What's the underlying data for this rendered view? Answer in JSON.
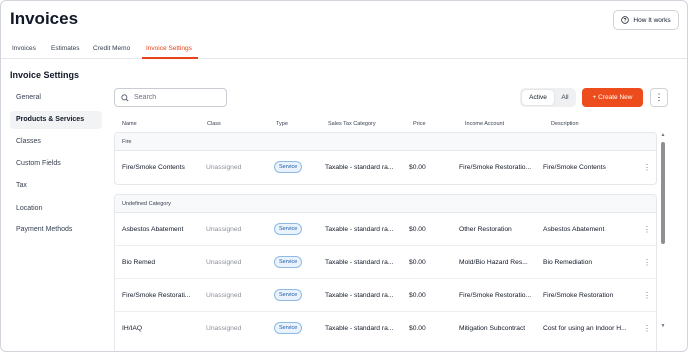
{
  "header": {
    "title": "Invoices",
    "how_label": "How It works",
    "how_icon": "help-circle-icon"
  },
  "tabs": [
    {
      "label": "Invoices"
    },
    {
      "label": "Estimates"
    },
    {
      "label": "Credit Memo"
    },
    {
      "label": "Invoice Settings",
      "active": true
    }
  ],
  "sidebar": {
    "title": "Invoice Settings",
    "items": [
      {
        "label": "General"
      },
      {
        "label": "Products & Services",
        "active": true
      },
      {
        "label": "Classes"
      },
      {
        "label": "Custom Fields"
      },
      {
        "label": "Tax"
      },
      {
        "label": "Location"
      },
      {
        "label": "Payment Methods"
      }
    ]
  },
  "toolbar": {
    "search_placeholder": "Search",
    "toggle_active": "Active",
    "toggle_all": "All",
    "create_label": "+ Create New",
    "more_icon": "kebab-icon"
  },
  "table": {
    "columns": [
      "Name",
      "Class",
      "Type",
      "Sales Tax Category",
      "Price",
      "Income Account",
      "Description"
    ],
    "groups": [
      {
        "name": "Fire",
        "rows": [
          {
            "name": "Fire/Smoke Contents",
            "class": "Unassigned",
            "type": "Service",
            "tax": "Taxable - standard ra...",
            "price": "$0.00",
            "income": "Fire/Smoke Restoratio...",
            "description": "Fire/Smoke Contents"
          }
        ]
      },
      {
        "name": "Undefined Category",
        "rows": [
          {
            "name": "Asbestos Abatement",
            "class": "Unassigned",
            "type": "Service",
            "tax": "Taxable - standard ra...",
            "price": "$0.00",
            "income": "Other Restoration",
            "description": "Asbestos Abatement"
          },
          {
            "name": "Bio Remed",
            "class": "Unassigned",
            "type": "Service",
            "tax": "Taxable - standard ra...",
            "price": "$0.00",
            "income": "Mold/Bio Hazard Res...",
            "description": "Bio Remediation"
          },
          {
            "name": "Fire/Smoke Restorati...",
            "class": "Unassigned",
            "type": "Service",
            "tax": "Taxable - standard ra...",
            "price": "$0.00",
            "income": "Fire/Smoke Restoratio...",
            "description": "Fire/Smoke Restoration"
          },
          {
            "name": "IH/IAQ",
            "class": "Unassigned",
            "type": "Service",
            "tax": "Taxable - standard ra...",
            "price": "$0.00",
            "income": "Mitigation Subcontract",
            "description": "Cost for using an Indoor H..."
          }
        ]
      }
    ]
  },
  "colors": {
    "accent": "#ed4d1c",
    "badge_border": "#8dbbe8",
    "badge_text": "#1d5aa6"
  }
}
